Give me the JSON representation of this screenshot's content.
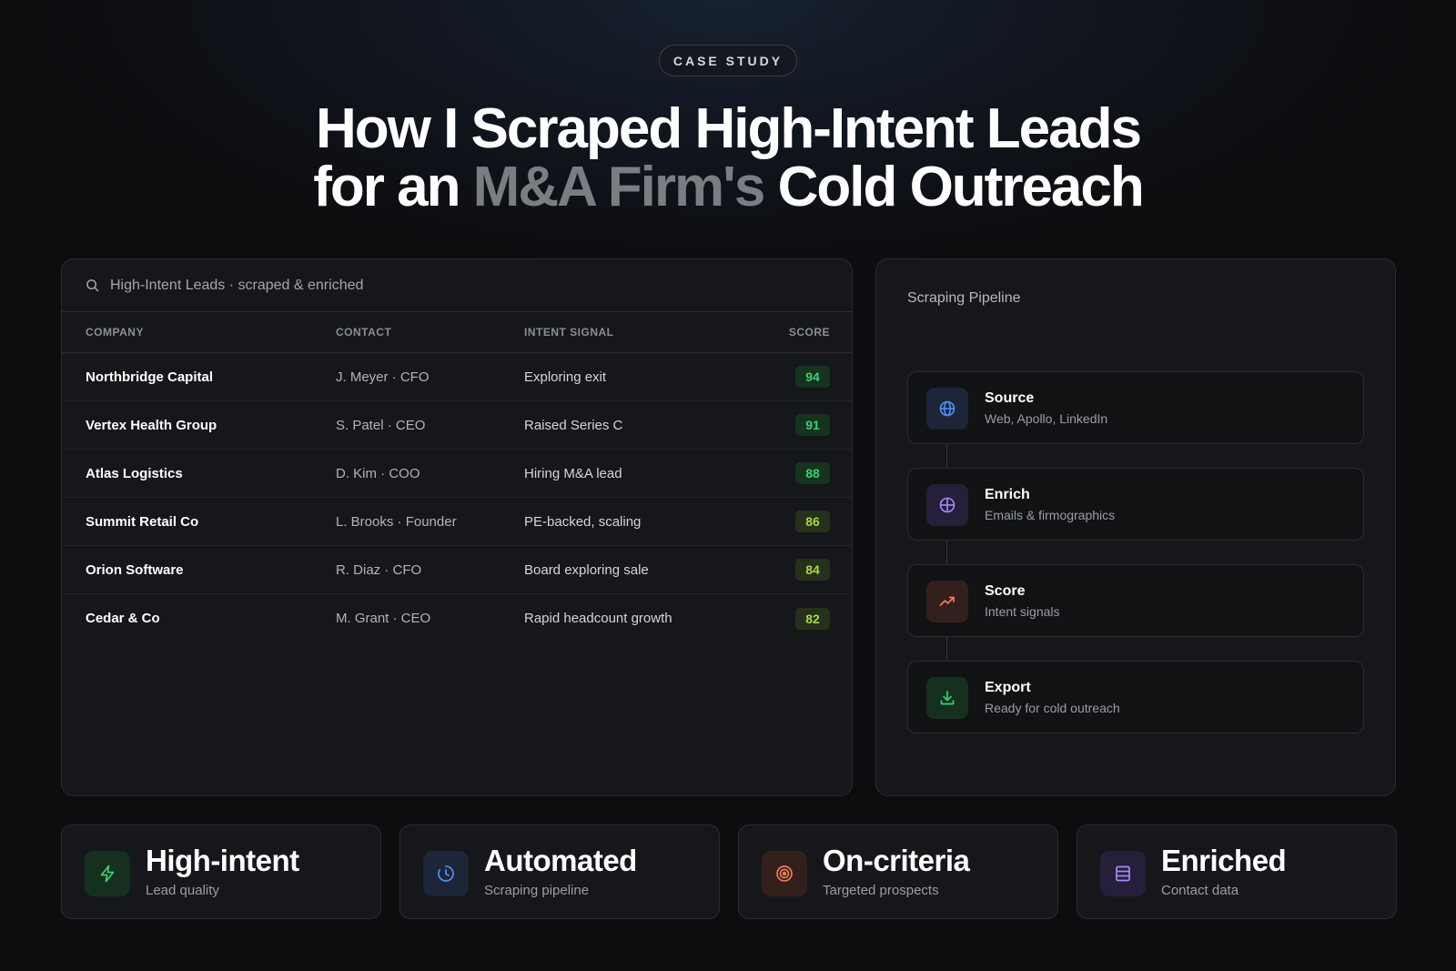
{
  "badge": "CASE STUDY",
  "headline": {
    "line1": "How I Scraped High-Intent Leads",
    "line2_pre": "for an ",
    "line2_highlight": "M&A Firm's",
    "line2_post": " Cold Outreach"
  },
  "leads": {
    "search_label": "High-Intent Leads · scraped & enriched",
    "columns": [
      "COMPANY",
      "CONTACT",
      "INTENT SIGNAL",
      "SCORE"
    ],
    "rows": [
      {
        "company": "Northbridge Capital",
        "contact": "J. Meyer · CFO",
        "intent": "Exploring exit",
        "score": "94"
      },
      {
        "company": "Vertex Health Group",
        "contact": "S. Patel · CEO",
        "intent": "Raised Series C",
        "score": "91"
      },
      {
        "company": "Atlas Logistics",
        "contact": "D. Kim · COO",
        "intent": "Hiring M&A lead",
        "score": "88"
      },
      {
        "company": "Summit Retail Co",
        "contact": "L. Brooks · Founder",
        "intent": "PE-backed, scaling",
        "score": "86"
      },
      {
        "company": "Orion Software",
        "contact": "R. Diaz · CFO",
        "intent": "Board exploring sale",
        "score": "84"
      },
      {
        "company": "Cedar & Co",
        "contact": "M. Grant · CEO",
        "intent": "Rapid headcount growth",
        "score": "82"
      }
    ]
  },
  "pipeline": {
    "title": "Scraping Pipeline",
    "steps": [
      {
        "name": "Source",
        "desc": "Web, Apollo, LinkedIn",
        "icon": "globe-icon",
        "color": "#4f8ff7",
        "bg": "#1c2638"
      },
      {
        "name": "Enrich",
        "desc": "Emails & firmographics",
        "icon": "crosshair-icon",
        "color": "#a78bfa",
        "bg": "#251f3a"
      },
      {
        "name": "Score",
        "desc": "Intent signals",
        "icon": "trending-up-icon",
        "color": "#f07a5a",
        "bg": "#33201c"
      },
      {
        "name": "Export",
        "desc": "Ready for cold outreach",
        "icon": "download-icon",
        "color": "#3ecf6e",
        "bg": "#16301f"
      }
    ]
  },
  "stats": [
    {
      "value": "High-intent",
      "label": "Lead quality",
      "icon": "lightning-icon",
      "color": "#3ecf6e",
      "bg": "#16301f"
    },
    {
      "value": "Automated",
      "label": "Scraping pipeline",
      "icon": "clock-icon",
      "color": "#4f8ff7",
      "bg": "#1c2638"
    },
    {
      "value": "On-criteria",
      "label": "Targeted prospects",
      "icon": "target-icon",
      "color": "#f07a5a",
      "bg": "#33201c"
    },
    {
      "value": "Enriched",
      "label": "Contact data",
      "icon": "database-icon",
      "color": "#a78bfa",
      "bg": "#251f3a"
    }
  ],
  "score_colors": {
    "high": "#3ecf6e",
    "mid": "#a3d84a",
    "high_bg": "#173320",
    "mid_bg": "#26301a"
  }
}
